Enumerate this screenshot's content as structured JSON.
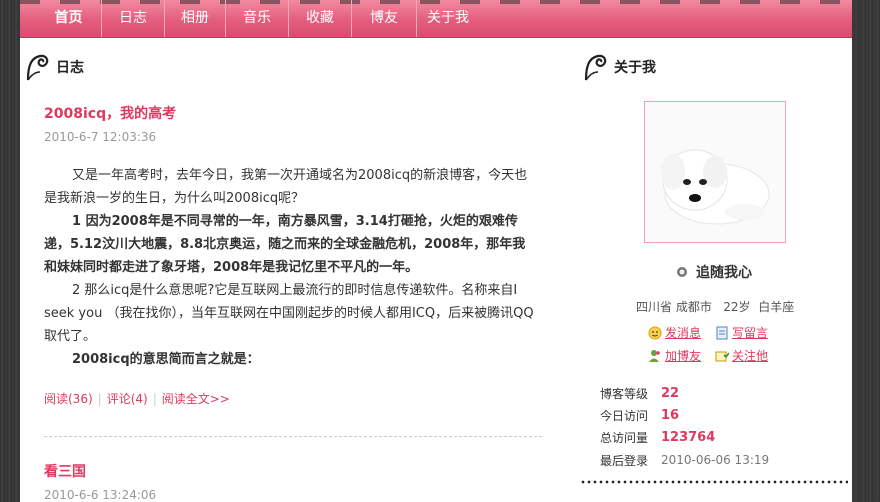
{
  "nav": {
    "items": [
      {
        "label": "首页",
        "active": true
      },
      {
        "label": "日志",
        "active": false
      },
      {
        "label": "相册",
        "active": false
      },
      {
        "label": "音乐",
        "active": false
      },
      {
        "label": "收藏",
        "active": false
      },
      {
        "label": "博友",
        "active": false
      },
      {
        "label": "关于我",
        "active": false
      }
    ]
  },
  "left_section": {
    "title": "日志"
  },
  "posts": [
    {
      "title": "2008icq，我的高考",
      "date": "2010-6-7 12:03:36",
      "paragraphs": [
        "又是一年高考时，去年今日，我第一次开通域名为2008icq的新浪博客，今天也是我新浪一岁的生日，为什么叫2008icq呢？",
        "1 因为2008年是不同寻常的一年，南方暴风雪，3.14打砸抢，火炬的艰难传递，5.12汶川大地震，8.8北京奥运，随之而来的全球金融危机，2008年，那年我和妹妹同时都走进了象牙塔，2008年是我记忆里不平凡的一年。",
        "2 那么icq是什么意思呢?它是互联网上最流行的即时信息传递软件。名称来自I seek you （我在找你），当年互联网在中国刚起步的时候人都用ICQ，后来被腾讯QQ取代了。",
        "2008icq的意思简而言之就是："
      ],
      "read": "阅读(36)",
      "comment": "评论(4)",
      "more": "阅读全文>>"
    },
    {
      "title": "看三国",
      "date": "2010-6-6 13:24:06"
    }
  ],
  "right_section": {
    "title": "关于我"
  },
  "profile": {
    "name": "追随我心",
    "location": "四川省 成都市",
    "age": "22岁",
    "sign": "白羊座",
    "actions": {
      "message": "发消息",
      "comment": "写留言",
      "add_friend": "加博友",
      "follow": "关注他"
    }
  },
  "stats": [
    {
      "label": "博客等级",
      "value": "22"
    },
    {
      "label": "今日访问",
      "value": "16"
    },
    {
      "label": "总访问量",
      "value": "123764"
    },
    {
      "label": "最后登录",
      "value": "2010-06-06 13:19"
    }
  ],
  "colors": {
    "accent": "#e0385f",
    "nav": "#e45d7d"
  }
}
